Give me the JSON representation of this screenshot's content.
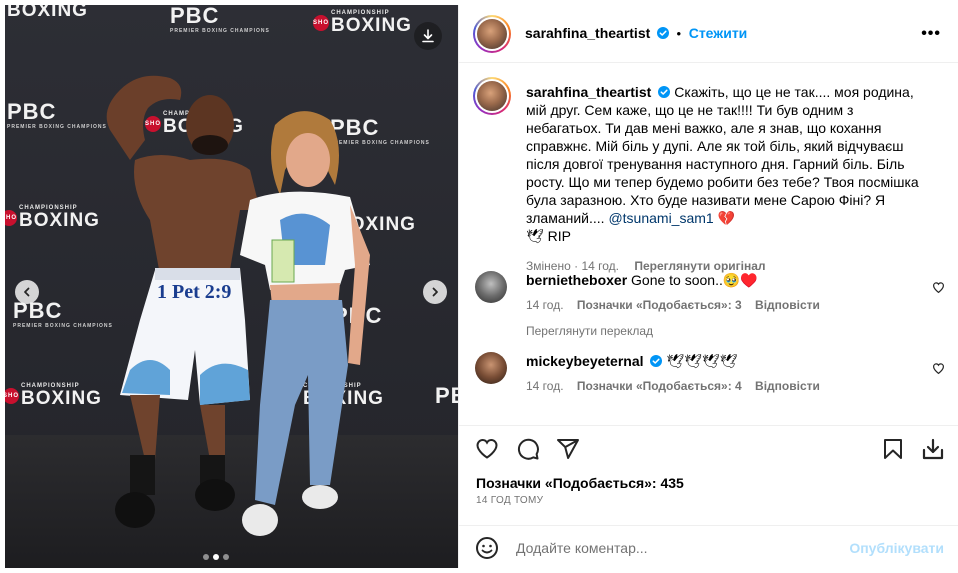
{
  "header": {
    "username": "sarahfina_theartist",
    "follow_label": "Стежити",
    "more_label": "•••"
  },
  "media": {
    "backdrop_logos": {
      "pbc": "PBC",
      "pbc_sub": "PREMIER BOXING CHAMPIONS",
      "sho": "SHO",
      "championship": "CHAMPIONSHIP",
      "boxing": "BOXING"
    },
    "trunks_text": "1 Pet 2:9",
    "slides": 3,
    "active_slide": 2
  },
  "caption": {
    "username": "sarahfina_theartist",
    "text": "Скажіть, що це не так.... моя родина, мій друг. Сем каже, що це не так!!!! Ти був одним з небагатьох. Ти дав мені важко, але я знав, що кохання справжнє. Мій біль у дупі. Але як той біль, який відчуваєш після довгої тренування наступного дня. Гарний біль. Біль росту. Що ми тепер будемо робити без тебе? Твоя посмішка була заразною. Хто буде називати мене Сарою Фіні? Я зламаний.... ",
    "mention": "@tsunami_sam1",
    "suffix": " 💔",
    "line2": "🕊 RIP",
    "meta_edited": "Змінено",
    "meta_sep": " · ",
    "meta_time": "14 год.",
    "meta_translate": "Переглянути оригінал"
  },
  "comments": [
    {
      "username": "bernietheboxer",
      "text": "Gone to soon..🥹♥️",
      "time": "14 год.",
      "likes": "Позначки «Подобається»: 3",
      "reply": "Відповісти",
      "translate": "Переглянути переклад"
    },
    {
      "username": "mickeybeyeternal",
      "text": "🕊🕊🕊🕊",
      "time": "14 год.",
      "likes": "Позначки «Подобається»: 4",
      "reply": "Відповісти"
    }
  ],
  "footer": {
    "likes_label": "Позначки «Подобається»: 435",
    "time_ago": "14 ГОД ТОМУ",
    "comment_placeholder": "Додайте коментар...",
    "post_label": "Опублікувати"
  },
  "colors": {
    "accent": "#0095f6",
    "mention": "#00376b",
    "muted": "#737373",
    "post_disabled": "#b2dffc"
  }
}
